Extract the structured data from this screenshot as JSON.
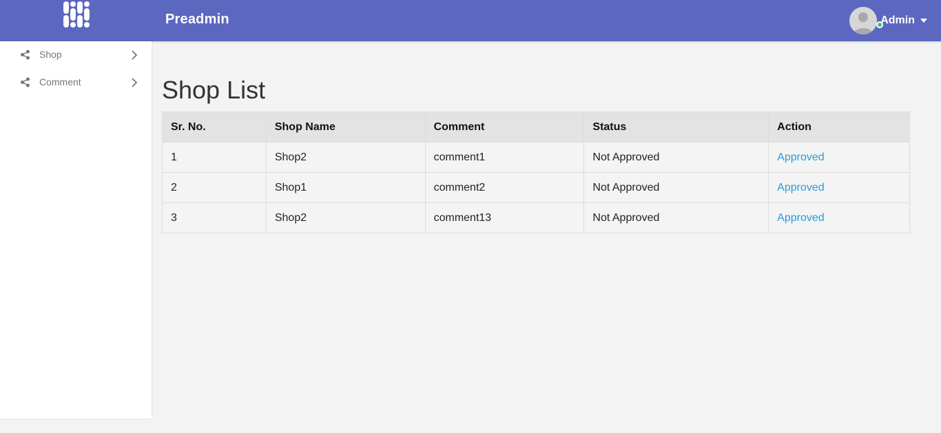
{
  "header": {
    "brand": "Preadmin",
    "logo_icon": "dots-logo-icon",
    "user_name": "Admin",
    "accent_color": "#5c67c0"
  },
  "sidebar": {
    "items": [
      {
        "label": "Shop",
        "icon": "share-icon"
      },
      {
        "label": "Comment",
        "icon": "share-icon"
      }
    ]
  },
  "main": {
    "title": "Shop List",
    "table": {
      "headers": [
        "Sr. No.",
        "Shop Name",
        "Comment",
        "Status",
        "Action"
      ],
      "rows": [
        [
          "1",
          "Shop2",
          "comment1",
          "Not Approved",
          "Approved"
        ],
        [
          "2",
          "Shop1",
          "comment2",
          "Not Approved",
          "Approved"
        ],
        [
          "3",
          "Shop2",
          "comment13",
          "Not Approved",
          "Approved"
        ]
      ]
    },
    "link_color": "#2b9ad6"
  }
}
